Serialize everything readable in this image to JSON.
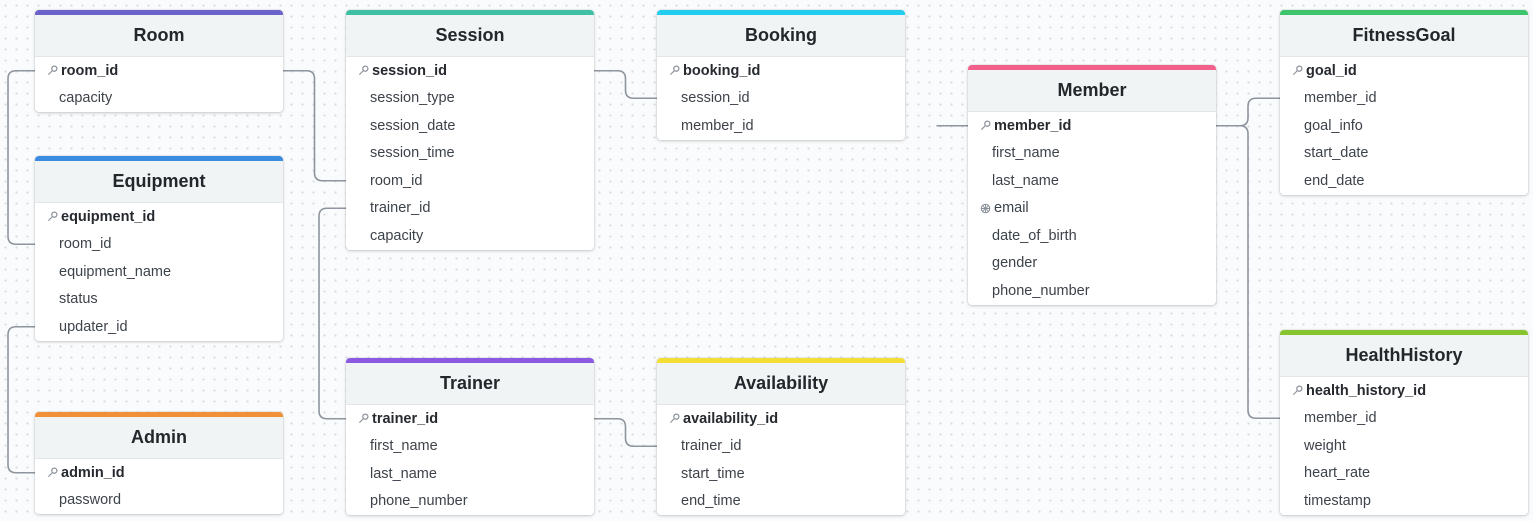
{
  "tables": [
    {
      "id": "room",
      "name": "Room",
      "color": "#6b63c9",
      "fields": [
        {
          "name": "room_id",
          "icon": "key-icon",
          "pk": true
        },
        {
          "name": "capacity"
        }
      ]
    },
    {
      "id": "equipment",
      "name": "Equipment",
      "color": "#3b8be0",
      "fields": [
        {
          "name": "equipment_id",
          "icon": "key-icon",
          "pk": true
        },
        {
          "name": "room_id"
        },
        {
          "name": "equipment_name"
        },
        {
          "name": "status"
        },
        {
          "name": "updater_id"
        }
      ]
    },
    {
      "id": "admin",
      "name": "Admin",
      "color": "#f0913a",
      "fields": [
        {
          "name": "admin_id",
          "icon": "key-icon",
          "pk": true
        },
        {
          "name": "password"
        }
      ]
    },
    {
      "id": "session",
      "name": "Session",
      "color": "#3fbfa3",
      "fields": [
        {
          "name": "session_id",
          "icon": "key-icon",
          "pk": true
        },
        {
          "name": "session_type"
        },
        {
          "name": "session_date"
        },
        {
          "name": "session_time"
        },
        {
          "name": "room_id"
        },
        {
          "name": "trainer_id"
        },
        {
          "name": "capacity"
        }
      ]
    },
    {
      "id": "trainer",
      "name": "Trainer",
      "color": "#8b5ae0",
      "fields": [
        {
          "name": "trainer_id",
          "icon": "key-icon",
          "pk": true
        },
        {
          "name": "first_name"
        },
        {
          "name": "last_name"
        },
        {
          "name": "phone_number"
        }
      ]
    },
    {
      "id": "booking",
      "name": "Booking",
      "color": "#22cdef",
      "fields": [
        {
          "name": "booking_id",
          "icon": "key-icon",
          "pk": true
        },
        {
          "name": "session_id"
        },
        {
          "name": "member_id"
        }
      ]
    },
    {
      "id": "availability",
      "name": "Availability",
      "color": "#f3de35",
      "fields": [
        {
          "name": "availability_id",
          "icon": "key-icon",
          "pk": true
        },
        {
          "name": "trainer_id"
        },
        {
          "name": "start_time"
        },
        {
          "name": "end_time"
        }
      ]
    },
    {
      "id": "member",
      "name": "Member",
      "color": "#f0608a",
      "fields": [
        {
          "name": "member_id",
          "icon": "key-icon",
          "pk": true
        },
        {
          "name": "first_name"
        },
        {
          "name": "last_name"
        },
        {
          "name": "email",
          "icon": "unique-icon"
        },
        {
          "name": "date_of_birth"
        },
        {
          "name": "gender"
        },
        {
          "name": "phone_number"
        }
      ]
    },
    {
      "id": "fitnessgoal",
      "name": "FitnessGoal",
      "color": "#3ec46d",
      "fields": [
        {
          "name": "goal_id",
          "icon": "key-icon",
          "pk": true
        },
        {
          "name": "member_id"
        },
        {
          "name": "goal_info"
        },
        {
          "name": "start_date"
        },
        {
          "name": "end_date"
        }
      ]
    },
    {
      "id": "healthhistory",
      "name": "HealthHistory",
      "color": "#86c52d",
      "fields": [
        {
          "name": "health_history_id",
          "icon": "key-icon",
          "pk": true
        },
        {
          "name": "member_id"
        },
        {
          "name": "weight"
        },
        {
          "name": "heart_rate"
        },
        {
          "name": "timestamp"
        }
      ]
    }
  ],
  "relationships": [
    {
      "from": "room.room_id",
      "to": "equipment.room_id"
    },
    {
      "from": "admin.admin_id",
      "to": "equipment.updater_id"
    },
    {
      "from": "room.room_id",
      "to": "session.room_id"
    },
    {
      "from": "trainer.trainer_id",
      "to": "session.trainer_id"
    },
    {
      "from": "session.session_id",
      "to": "booking.session_id"
    },
    {
      "from": "trainer.trainer_id",
      "to": "availability.trainer_id"
    },
    {
      "from": "member.member_id",
      "to": "booking.member_id"
    },
    {
      "from": "member.member_id",
      "to": "fitnessgoal.member_id"
    },
    {
      "from": "member.member_id",
      "to": "healthhistory.member_id"
    }
  ]
}
